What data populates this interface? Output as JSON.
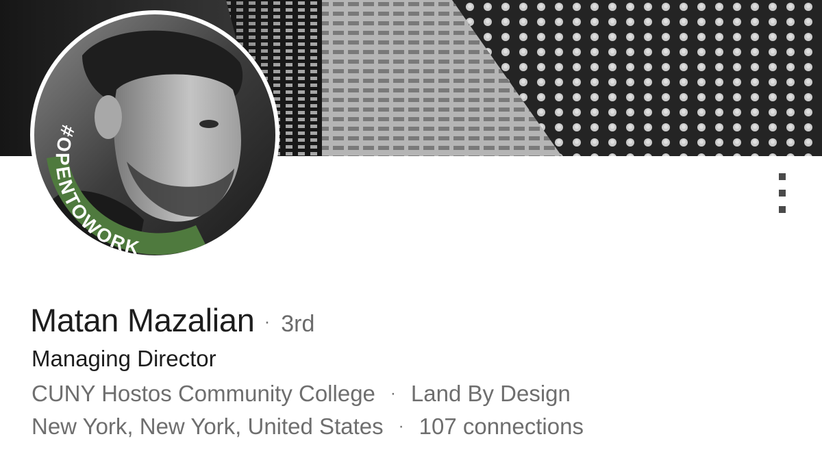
{
  "profile": {
    "name": "Matan Mazalian",
    "degree": "3rd",
    "headline": "Managing Director",
    "education": "CUNY Hostos Community College",
    "company": "Land By Design",
    "location": "New York, New York, United States",
    "connections": "107 connections",
    "separator": "·",
    "badge_text": "#OPENTOWORK"
  },
  "colors": {
    "badge_green": "#4f7a3e",
    "name_text": "#1d1d1d",
    "secondary_text": "#6e6e6e"
  },
  "icons": {
    "more": "vertical-ellipsis-icon"
  }
}
